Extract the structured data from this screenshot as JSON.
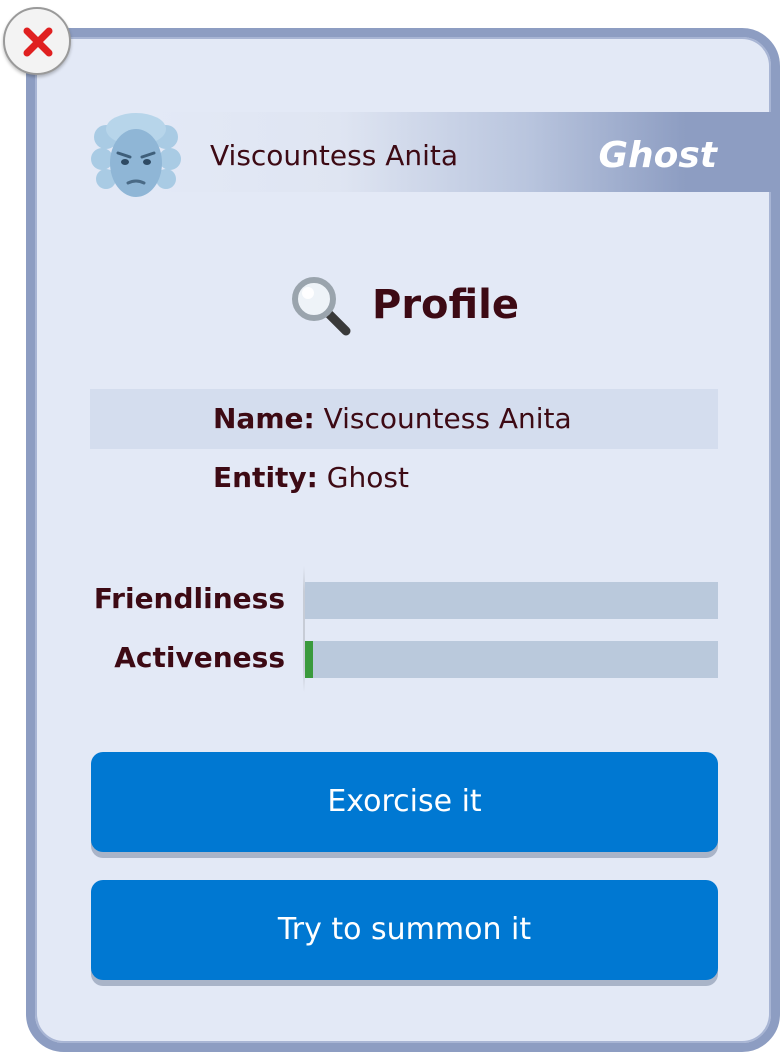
{
  "header": {
    "name": "Viscountess Anita",
    "type": "Ghost"
  },
  "profile": {
    "title": "Profile",
    "name_label": "Name:",
    "name_value": "Viscountess Anita",
    "entity_label": "Entity:",
    "entity_value": "Ghost"
  },
  "stats": [
    {
      "label": "Friendliness",
      "value": 0.0
    },
    {
      "label": "Activeness",
      "value": 0.02
    }
  ],
  "actions": {
    "exorcise_label": "Exorcise it",
    "summon_label": "Try to summon it"
  },
  "colors": {
    "button_blue": "#0078d2",
    "text_maroon": "#3d0a14",
    "bar_fill_green": "#3a9a3c",
    "close_x_red": "#e02020"
  },
  "icons": {
    "close": "close-icon",
    "avatar": "ghost-avatar",
    "profile": "magnifying-glass-icon"
  }
}
